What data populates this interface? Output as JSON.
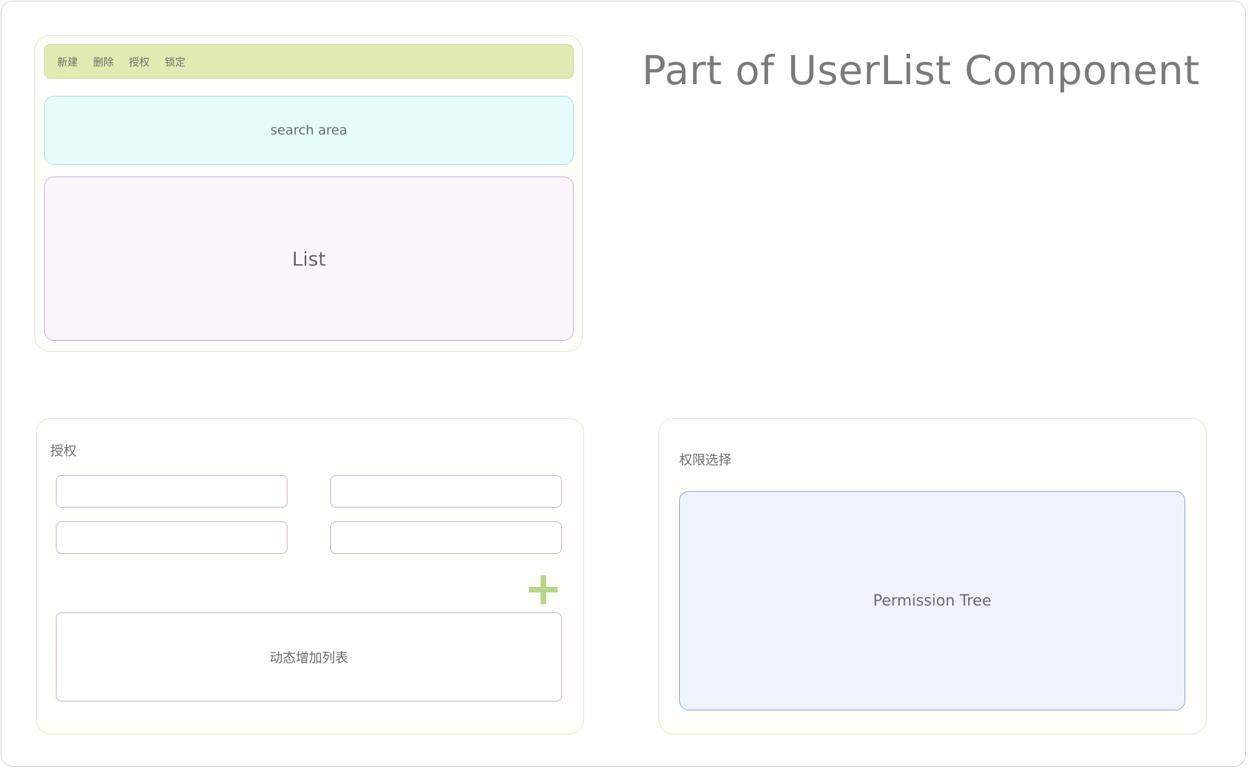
{
  "page": {
    "title": "Part of UserList Component"
  },
  "userlist": {
    "toolbar": [
      "新建",
      "删除",
      "授权",
      "锁定"
    ],
    "search_label": "search area",
    "list_label": "List"
  },
  "auth": {
    "title": "授权",
    "dynamic_list_label": "动态增加列表",
    "add_icon": "plus-icon"
  },
  "permission": {
    "title": "权限选择",
    "tree_label": "Permission Tree"
  },
  "colors": {
    "toolbar_bg": "#dfebb0",
    "search_bg": "#e6fcfb",
    "list_bg": "#fcf5fd",
    "tree_bg": "#eff3fe",
    "plus": "#b6d78a"
  }
}
